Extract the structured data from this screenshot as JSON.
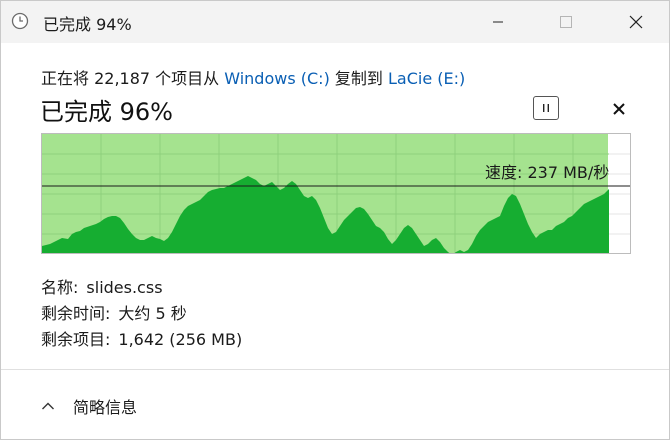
{
  "window": {
    "title": "已完成 94%",
    "icons": {
      "app": "clock-icon",
      "minimize": "minimize-icon",
      "maximize": "maximize-icon",
      "close": "close-icon"
    }
  },
  "copy": {
    "prefix": "正在将 22,187 个项目从 ",
    "source": "Windows (C:)",
    "middle": " 复制到 ",
    "destination": "LaCie (E:)"
  },
  "progress": {
    "title": "已完成 96%",
    "percent": 96,
    "pause_icon": "pause-icon",
    "stop_icon": "stop-icon"
  },
  "graph": {
    "speed_label": "速度: 237 MB/秒",
    "fill_color": "#16ad31",
    "background_color": "#a5e38f",
    "grid_color": "#8fd07c"
  },
  "details": {
    "name_label": "名称:",
    "name_value": "slides.css",
    "time_label": "剩余时间:",
    "time_value": "大约 5 秒",
    "items_label": "剩余项目:",
    "items_value": "1,642 (256 MB)"
  },
  "footer": {
    "toggle_label": "简略信息",
    "toggle_icon": "chevron-up-icon"
  }
}
